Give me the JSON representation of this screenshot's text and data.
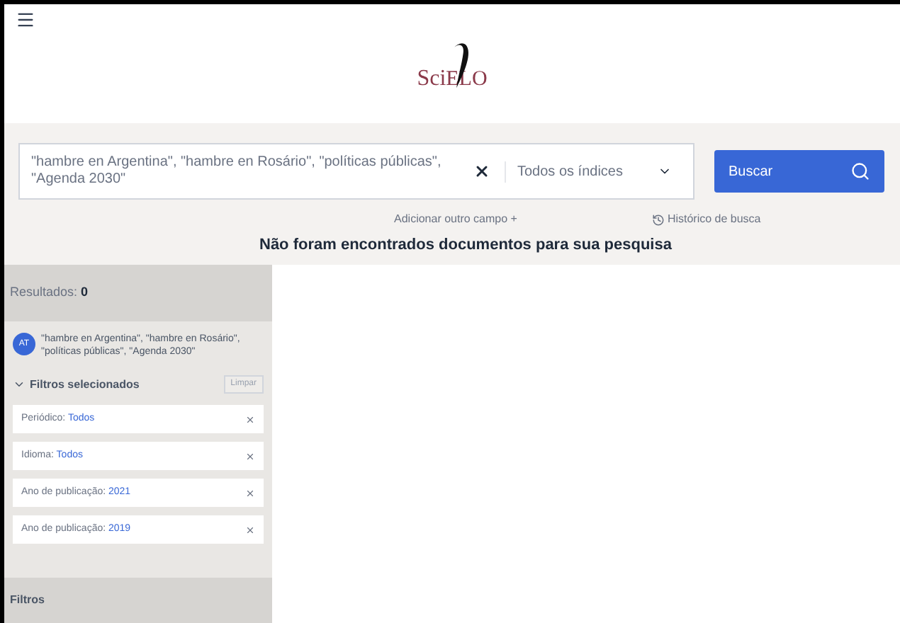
{
  "header": {
    "logo_prefix": "Sci",
    "logo_suffix": "ELO"
  },
  "search": {
    "query": "\"hambre en Argentina\", \"hambre en Rosário\", \"políticas públicas\", \"Agenda 2030\"",
    "index": "Todos os índices",
    "button": "Buscar",
    "add_field": "Adicionar outro campo +",
    "history": "Histórico de busca"
  },
  "message": "Não foram encontrados documentos para sua pesquisa",
  "sidebar": {
    "results_label": "Resultados:",
    "results_count": "0",
    "query_badge": "AT",
    "query": "\"hambre en Argentina\", \"hambre en Rosário\", \"políticas públicas\", \"Agenda 2030\"",
    "filters_title": "Filtros selecionados",
    "expanded": true,
    "clear": "Limpar",
    "filters": [
      {
        "label": "Periódico:",
        "value": "Todos"
      },
      {
        "label": "Idioma:",
        "value": "Todos"
      },
      {
        "label": "Ano de publicação:",
        "value": "2021"
      },
      {
        "label": "Ano de publicação:",
        "value": "2019"
      }
    ],
    "footer": "Filtros"
  }
}
